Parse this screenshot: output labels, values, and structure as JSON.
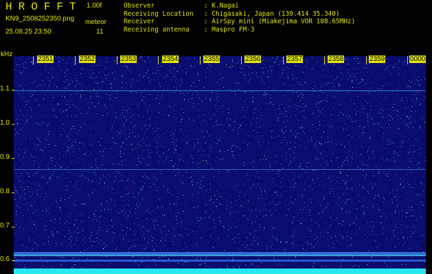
{
  "header": {
    "title": "HROFFT",
    "version": "1.00f",
    "filename": "KN9_2508252350.png",
    "datetime": "25.08.25 23:50",
    "meteor_label": "meteor",
    "meteor_value": "11"
  },
  "info": [
    {
      "key": "Observer",
      "value": ": K.Nagai"
    },
    {
      "key": "Receiving Location",
      "value": ": Chigasaki, Japan (139.414 35.340)"
    },
    {
      "key": "Receiver",
      "value": ": AirSpy mini (Miakejima VOR 108.65MHz)"
    },
    {
      "key": "Receiving antenna",
      "value": ": Maspro FM-3"
    }
  ],
  "axis": {
    "y_unit": "kHz",
    "y_ticks": [
      "1.1",
      "1.0",
      "0.9",
      "0.8",
      "0.7",
      "0.6"
    ],
    "time_ticks": [
      "2351",
      "2352",
      "2353",
      "2354",
      "2355",
      "2356",
      "2357",
      "2358",
      "2359",
      "0000"
    ]
  },
  "colors": {
    "label": "#e6e600",
    "background": "#0a0d6e",
    "cyan": "#26e8f0"
  }
}
